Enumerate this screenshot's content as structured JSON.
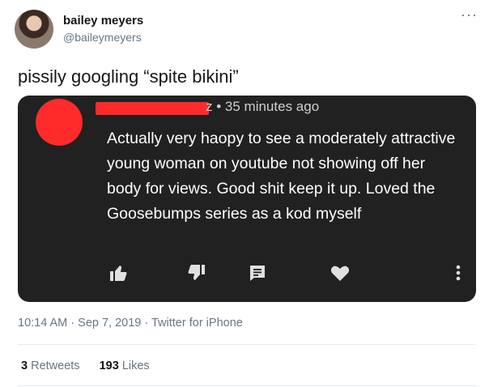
{
  "tweet": {
    "display_name": "bailey meyers",
    "handle": "@baileymeyers",
    "text": "pissily googling “spite bikini”",
    "more_icon": "more-icon"
  },
  "embed": {
    "timestamp_prefix": "z • ",
    "timestamp": "35 minutes ago",
    "comment": "Actually very haopy to see a moderately attractive young woman on youtube not showing off her body for views. Good shit keep it up. Loved the Goosebumps series as a kod myself",
    "actions": [
      "like-icon",
      "dislike-icon",
      "reply-icon",
      "heart-icon",
      "more-vert-icon"
    ]
  },
  "meta": {
    "time": "10:14 AM",
    "sep1": " · ",
    "date": "Sep 7, 2019",
    "sep2": " · ",
    "source": "Twitter for iPhone"
  },
  "stats": {
    "retweets_count": "3",
    "retweets_label": "Retweets",
    "likes_count": "193",
    "likes_label": "Likes"
  },
  "colors": {
    "embed_bg": "#212121",
    "redaction": "#ff2a2a",
    "secondary_text": "#657786"
  }
}
